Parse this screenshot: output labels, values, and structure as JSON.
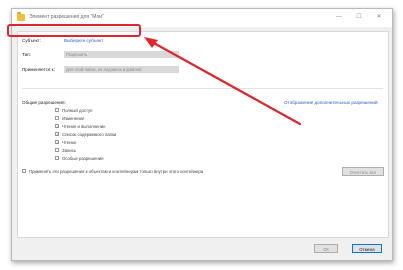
{
  "window": {
    "title": "Элемент разрешения для \"Мои\"",
    "minimize": "—",
    "maximize": "☐",
    "close": "✕"
  },
  "subject": {
    "label": "Субъект:",
    "link": "Выберите субъект"
  },
  "type": {
    "label": "Тип:",
    "value": "Разрешить"
  },
  "applies": {
    "label": "Применяется к:",
    "value": "Для этой папки, ее подпапок и файлов"
  },
  "permissions": {
    "header": "Общие разрешения:",
    "advanced_link": "Отображение дополнительных разрешений",
    "items": [
      {
        "label": "Полный доступ",
        "checked": false
      },
      {
        "label": "Изменение",
        "checked": false
      },
      {
        "label": "Чтение и выполнение",
        "checked": true
      },
      {
        "label": "Список содержимого папки",
        "checked": true
      },
      {
        "label": "Чтение",
        "checked": true
      },
      {
        "label": "Запись",
        "checked": false
      },
      {
        "label": "Особые разрешения",
        "checked": false
      }
    ],
    "apply_inside": "Применять эти разрешения к объектам и контейнерам только внутри этого контейнера",
    "clear_all": "Очистить все"
  },
  "buttons": {
    "ok": "ОК",
    "cancel": "Отмена"
  },
  "colors": {
    "highlight": "#e0252b",
    "link": "#2a5fbf"
  }
}
